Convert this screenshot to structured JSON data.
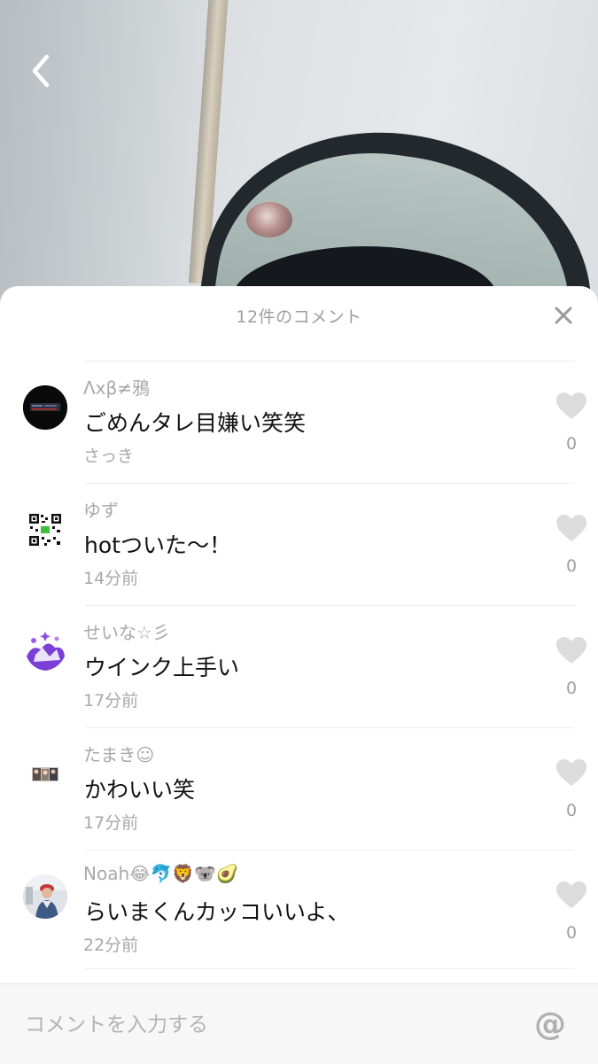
{
  "header": {
    "title": "12件のコメント"
  },
  "comments": [
    {
      "username": "Λxβ≠鴉",
      "text": "ごめんタレ目嫌い笑笑",
      "time": "さっき",
      "likes": "0",
      "avatar": "dark-screen-avatar"
    },
    {
      "username": "ゆず",
      "text": "hotついた〜！",
      "time": "14分前",
      "likes": "0",
      "avatar": "qr-code-avatar"
    },
    {
      "username": "せいな☆彡",
      "text": "ウインク上手い",
      "time": "17分前",
      "likes": "0",
      "avatar": "purple-art-avatar"
    },
    {
      "username": "たまき☺",
      "text": "かわいい笑",
      "time": "17分前",
      "likes": "0",
      "avatar": "small-photo-avatar"
    },
    {
      "username": "Noah😂🐬🦁🐨🥑",
      "text": "らいまくんカッコいいよ、",
      "time": "22分前",
      "likes": "0",
      "avatar": "person-photo-avatar"
    }
  ],
  "input": {
    "placeholder": "コメントを入力する",
    "mention_symbol": "@"
  },
  "colors": {
    "sheet_background": "#ffffff",
    "secondary_text": "#a8a8a8",
    "heart": "#dcdcdc"
  }
}
